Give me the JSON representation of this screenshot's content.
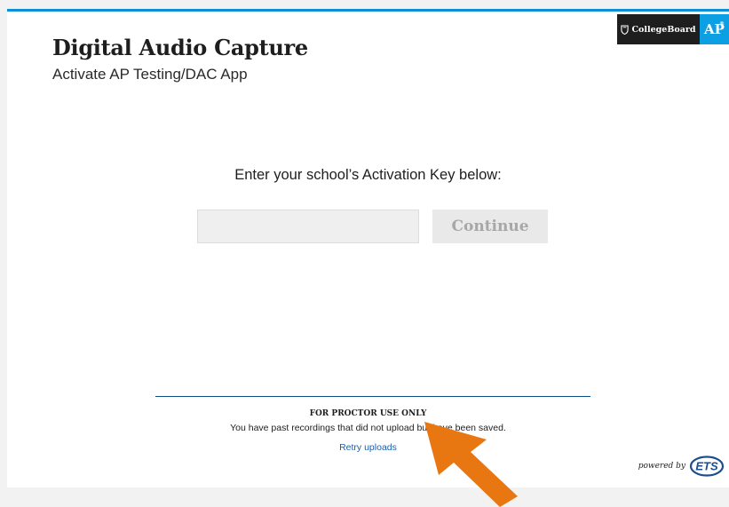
{
  "header": {
    "title": "Digital Audio Capture",
    "subtitle": "Activate AP Testing/DAC App"
  },
  "branding": {
    "collegeboard_label": "CollegeBoard",
    "ap_label": "AP",
    "ap_mark": "®",
    "collegeboard_bg": "#1e1e1e",
    "ap_bg": "#0d9fe4"
  },
  "activation": {
    "prompt": "Enter your school’s Activation Key below:",
    "key_value": "",
    "key_placeholder": "",
    "continue_label": "Continue"
  },
  "proctor": {
    "heading": "FOR PROCTOR USE ONLY",
    "message": "You have past recordings that did not upload but have been saved.",
    "retry_label": "Retry uploads"
  },
  "footer": {
    "powered_by": "powered by",
    "ets_label": "ETS"
  },
  "colors": {
    "top_border": "#0b8fd6",
    "divider": "#0a4d82",
    "link": "#1b5fa8",
    "arrow": "#e87711"
  },
  "icons": {
    "collegeboard_logo": "acorn-shield-icon",
    "ets_logo": "ets-oval-logo",
    "annotation": "orange-arrow-icon"
  }
}
